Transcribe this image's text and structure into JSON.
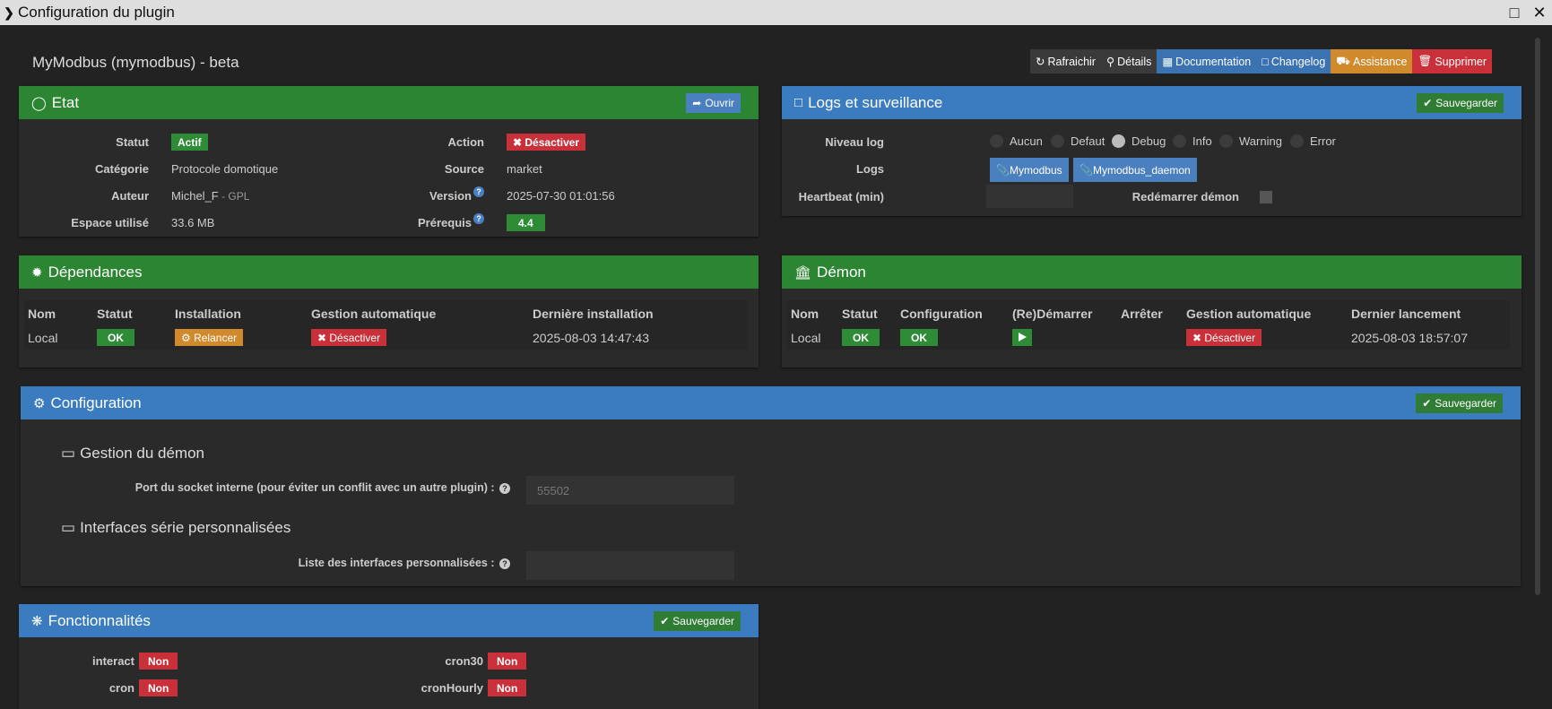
{
  "window": {
    "title": "Configuration du plugin"
  },
  "plugin": {
    "name": "MyModbus (mymodbus) - beta"
  },
  "toolbar": {
    "refresh": "Rafraichir",
    "details": "Détails",
    "documentation": "Documentation",
    "changelog": "Changelog",
    "assistance": "Assistance",
    "delete": "Supprimer"
  },
  "etat": {
    "title": "Etat",
    "open_btn": "Ouvrir",
    "statut_label": "Statut",
    "statut_value": "Actif",
    "action_label": "Action",
    "action_value": "Désactiver",
    "categorie_label": "Catégorie",
    "categorie_value": "Protocole domotique",
    "source_label": "Source",
    "source_value": "market",
    "auteur_label": "Auteur",
    "auteur_value": "Michel_F",
    "licence": " - GPL",
    "version_label": "Version",
    "version_value": "2025-07-30 01:01:56",
    "espace_label": "Espace utilisé",
    "espace_value": "33.6 MB",
    "prerequis_label": "Prérequis",
    "prerequis_value": "4.4"
  },
  "logs": {
    "title": "Logs et surveillance",
    "save": "Sauvegarder",
    "niveau_label": "Niveau log",
    "levels": [
      "Aucun",
      "Defaut",
      "Debug",
      "Info",
      "Warning",
      "Error"
    ],
    "selected": "Debug",
    "logs_label": "Logs",
    "log_buttons": [
      "Mymodbus",
      "Mymodbus_daemon"
    ],
    "heartbeat_label": "Heartbeat (min)",
    "heartbeat_value": "",
    "restart_label": "Redémarrer démon"
  },
  "dependances": {
    "title": "Dépendances",
    "headers": [
      "Nom",
      "Statut",
      "Installation",
      "Gestion automatique",
      "Dernière installation"
    ],
    "row": {
      "nom": "Local",
      "statut": "OK",
      "installation": "Relancer",
      "gestion": "Désactiver",
      "derniere": "2025-08-03 14:47:43"
    }
  },
  "demon": {
    "title": "Démon",
    "headers": [
      "Nom",
      "Statut",
      "Configuration",
      "(Re)Démarrer",
      "Arrêter",
      "Gestion automatique",
      "Dernier lancement"
    ],
    "row": {
      "nom": "Local",
      "statut": "OK",
      "configuration": "OK",
      "gestion": "Désactiver",
      "dernier": "2025-08-03 18:57:07"
    }
  },
  "configuration": {
    "title": "Configuration",
    "save": "Sauvegarder",
    "section1": "Gestion du démon",
    "port_label": "Port du socket interne (pour éviter un conflit avec un autre plugin) :",
    "port_placeholder": "55502",
    "section2": "Interfaces série personnalisées",
    "interfaces_label": "Liste des interfaces personnalisées :",
    "interfaces_value": ""
  },
  "fonctionnalites": {
    "title": "Fonctionnalités",
    "save": "Sauvegarder",
    "items": [
      {
        "name": "interact",
        "value": "Non"
      },
      {
        "name": "cron30",
        "value": "Non"
      },
      {
        "name": "cron",
        "value": "Non"
      },
      {
        "name": "cronHourly",
        "value": "Non"
      }
    ]
  },
  "colors": {
    "green_header": "#2c8532",
    "blue_header": "#3a7cbf",
    "danger": "#c9303a",
    "warning": "#d08a2c"
  }
}
